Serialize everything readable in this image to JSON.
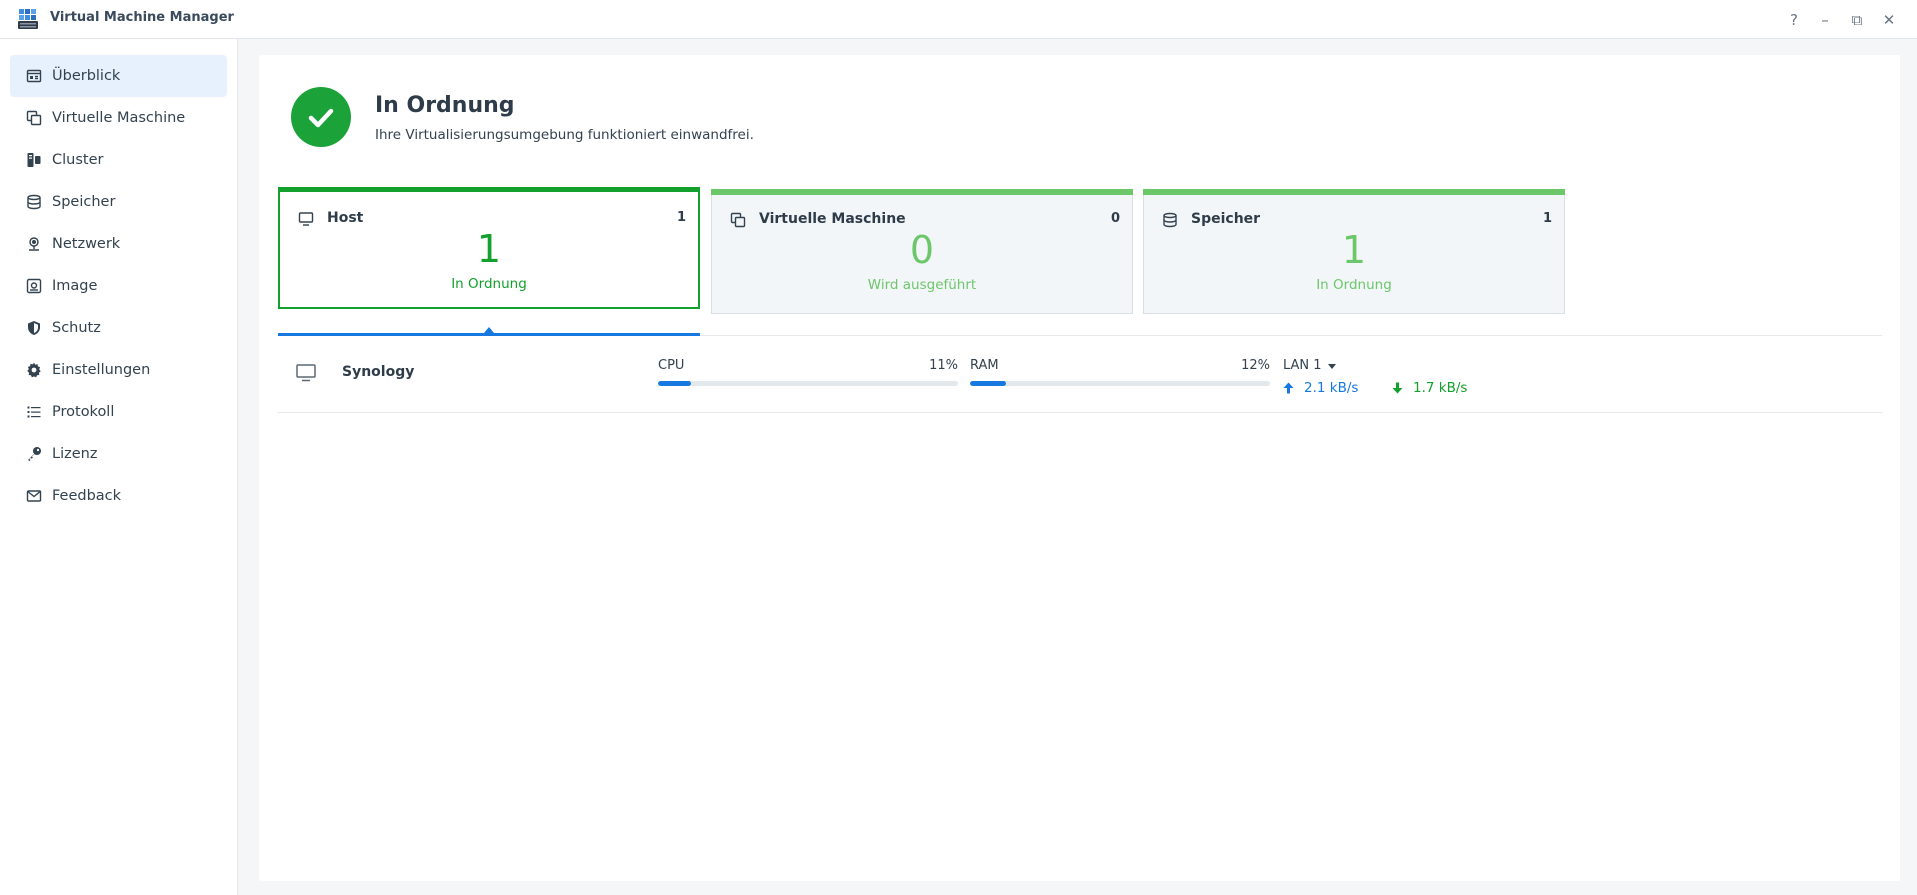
{
  "window": {
    "title": "Virtual Machine Manager",
    "help_glyph": "?",
    "minimize_glyph": "–",
    "restore_glyph": "⧉",
    "close_glyph": "✕"
  },
  "sidebar": {
    "items": [
      {
        "label": "Überblick",
        "icon": "overview-icon",
        "active": true
      },
      {
        "label": "Virtuelle Maschine",
        "icon": "vm-icon"
      },
      {
        "label": "Cluster",
        "icon": "cluster-icon"
      },
      {
        "label": "Speicher",
        "icon": "storage-icon"
      },
      {
        "label": "Netzwerk",
        "icon": "network-icon"
      },
      {
        "label": "Image",
        "icon": "image-icon"
      },
      {
        "label": "Schutz",
        "icon": "shield-icon"
      },
      {
        "label": "Einstellungen",
        "icon": "gear-icon"
      },
      {
        "label": "Protokoll",
        "icon": "log-icon"
      },
      {
        "label": "Lizenz",
        "icon": "key-icon"
      },
      {
        "label": "Feedback",
        "icon": "mail-icon"
      }
    ]
  },
  "status": {
    "title": "In Ordnung",
    "description": "Ihre Virtualisierungsumgebung funktioniert einwandfrei."
  },
  "cards": [
    {
      "title": "Host",
      "count": "1",
      "number": "1",
      "subtitle": "In Ordnung",
      "icon": "monitor-icon",
      "selected": true
    },
    {
      "title": "Virtuelle Maschine",
      "count": "0",
      "number": "0",
      "subtitle": "Wird ausgeführt",
      "icon": "vm-icon"
    },
    {
      "title": "Speicher",
      "count": "1",
      "number": "1",
      "subtitle": "In Ordnung",
      "icon": "storage-icon"
    }
  ],
  "host": {
    "name": "Synology",
    "cpu_label": "CPU",
    "cpu_value": "11%",
    "cpu_fraction": 0.11,
    "ram_label": "RAM",
    "ram_value": "12%",
    "ram_fraction": 0.12,
    "lan_label": "LAN 1",
    "upload": "2.1 kB/s",
    "download": "1.7 kB/s"
  },
  "colors": {
    "accent_blue": "#1779e0",
    "ok_green": "#13a02c",
    "light_green": "#6cc76a"
  }
}
